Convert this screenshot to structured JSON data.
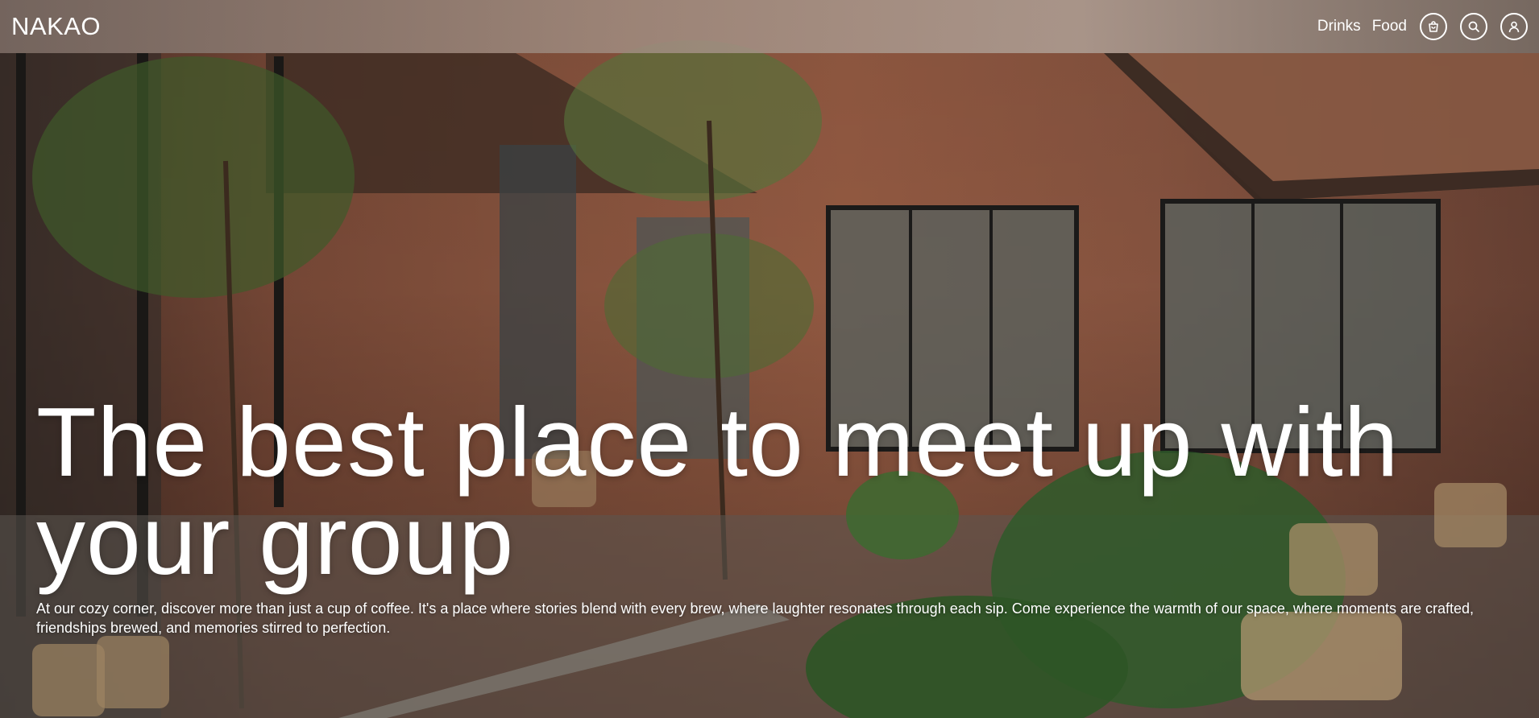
{
  "header": {
    "brand": "NAKAO",
    "nav": {
      "drinks": "Drinks",
      "food": "Food"
    },
    "icons": [
      "cart-icon",
      "search-icon",
      "user-icon"
    ]
  },
  "hero": {
    "title": "The best place to meet up with your group",
    "description": "At our cozy corner, discover more than just a cup of coffee. It's a place where stories blend with every brew, where laughter resonates through each sip. Come experience the warmth of our space, where moments are crafted, friendships brewed, and memories stirred to perfection."
  },
  "colors": {
    "text": "#ffffff",
    "header_overlay": "#9c8a80",
    "brick": "#8a553f"
  }
}
